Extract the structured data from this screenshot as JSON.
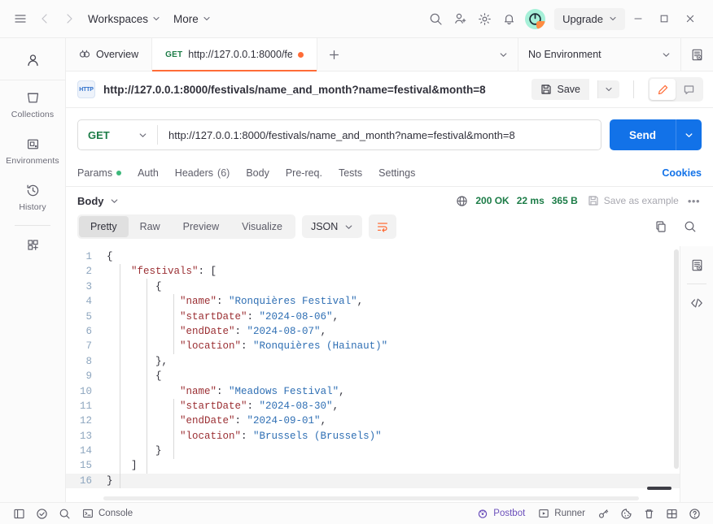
{
  "topbar": {
    "menu_icon": "hamburger-icon",
    "back_icon": "arrow-left-icon",
    "forward_icon": "arrow-right-icon",
    "workspaces_label": "Workspaces",
    "more_label": "More",
    "search_icon": "search-icon",
    "invite_icon": "invite-user-icon",
    "settings_icon": "gear-icon",
    "notifications_icon": "bell-icon",
    "avatar_label": "avatar",
    "upgrade_label": "Upgrade",
    "minimize_icon": "minimize-icon",
    "maximize_icon": "maximize-icon",
    "close_icon": "close-icon"
  },
  "sidebar": {
    "user_icon": "person-icon",
    "items": [
      {
        "label": "Collections",
        "icon": "collections-icon"
      },
      {
        "label": "Environments",
        "icon": "environments-icon"
      },
      {
        "label": "History",
        "icon": "history-clock-icon"
      }
    ],
    "add_module_icon": "grid-plus-icon"
  },
  "tabs": {
    "overview_label": "Overview",
    "request_method": "GET",
    "request_title": "http://127.0.0.1:8000/fe",
    "unsaved_dot": "unsaved-indicator",
    "new_tab_label": "+",
    "environment_label": "No Environment",
    "env_quick_look_icon": "environment-quick-look-icon"
  },
  "request": {
    "protocol_badge": "HTTP",
    "name": "http://127.0.0.1:8000/festivals/name_and_month?name=festival&month=8",
    "save_label": "Save",
    "edit_icon": "pencil-icon",
    "comment_icon": "comment-icon",
    "method": "GET",
    "url": "http://127.0.0.1:8000/festivals/name_and_month?name=festival&month=8",
    "send_label": "Send",
    "code_icon": "code-snippet-icon",
    "tabs": [
      {
        "label": "Params",
        "badge": "dot"
      },
      {
        "label": "Auth",
        "badge": ""
      },
      {
        "label": "Headers",
        "badge": "(6)"
      },
      {
        "label": "Body",
        "badge": ""
      },
      {
        "label": "Pre-req.",
        "badge": ""
      },
      {
        "label": "Tests",
        "badge": ""
      },
      {
        "label": "Settings",
        "badge": ""
      }
    ],
    "cookies_label": "Cookies"
  },
  "response": {
    "body_label": "Body",
    "globe_icon": "globe-icon",
    "status": "200 OK",
    "time": "22 ms",
    "size": "365 B",
    "save_example_label": "Save as example",
    "more_icon": "more-options-icon",
    "view_tabs": [
      {
        "label": "Pretty",
        "active": true
      },
      {
        "label": "Raw",
        "active": false
      },
      {
        "label": "Preview",
        "active": false
      },
      {
        "label": "Visualize",
        "active": false
      }
    ],
    "format": "JSON",
    "wrap_icon": "wrap-lines-icon",
    "copy_icon": "copy-icon",
    "search_icon": "search-icon",
    "body_lines": [
      {
        "n": 1,
        "indent": 0,
        "tokens": [
          {
            "t": "p",
            "v": "{"
          }
        ]
      },
      {
        "n": 2,
        "indent": 1,
        "tokens": [
          {
            "t": "k",
            "v": "\"festivals\""
          },
          {
            "t": "p",
            "v": ": ["
          }
        ]
      },
      {
        "n": 3,
        "indent": 2,
        "tokens": [
          {
            "t": "p",
            "v": "{"
          }
        ]
      },
      {
        "n": 4,
        "indent": 3,
        "tokens": [
          {
            "t": "k",
            "v": "\"name\""
          },
          {
            "t": "p",
            "v": ": "
          },
          {
            "t": "s",
            "v": "\"Ronquières Festival\""
          },
          {
            "t": "p",
            "v": ","
          }
        ]
      },
      {
        "n": 5,
        "indent": 3,
        "tokens": [
          {
            "t": "k",
            "v": "\"startDate\""
          },
          {
            "t": "p",
            "v": ": "
          },
          {
            "t": "s",
            "v": "\"2024-08-06\""
          },
          {
            "t": "p",
            "v": ","
          }
        ]
      },
      {
        "n": 6,
        "indent": 3,
        "tokens": [
          {
            "t": "k",
            "v": "\"endDate\""
          },
          {
            "t": "p",
            "v": ": "
          },
          {
            "t": "s",
            "v": "\"2024-08-07\""
          },
          {
            "t": "p",
            "v": ","
          }
        ]
      },
      {
        "n": 7,
        "indent": 3,
        "tokens": [
          {
            "t": "k",
            "v": "\"location\""
          },
          {
            "t": "p",
            "v": ": "
          },
          {
            "t": "s",
            "v": "\"Ronquières (Hainaut)\""
          }
        ]
      },
      {
        "n": 8,
        "indent": 2,
        "tokens": [
          {
            "t": "p",
            "v": "},"
          }
        ]
      },
      {
        "n": 9,
        "indent": 2,
        "tokens": [
          {
            "t": "p",
            "v": "{"
          }
        ]
      },
      {
        "n": 10,
        "indent": 3,
        "tokens": [
          {
            "t": "k",
            "v": "\"name\""
          },
          {
            "t": "p",
            "v": ": "
          },
          {
            "t": "s",
            "v": "\"Meadows Festival\""
          },
          {
            "t": "p",
            "v": ","
          }
        ]
      },
      {
        "n": 11,
        "indent": 3,
        "tokens": [
          {
            "t": "k",
            "v": "\"startDate\""
          },
          {
            "t": "p",
            "v": ": "
          },
          {
            "t": "s",
            "v": "\"2024-08-30\""
          },
          {
            "t": "p",
            "v": ","
          }
        ]
      },
      {
        "n": 12,
        "indent": 3,
        "tokens": [
          {
            "t": "k",
            "v": "\"endDate\""
          },
          {
            "t": "p",
            "v": ": "
          },
          {
            "t": "s",
            "v": "\"2024-09-01\""
          },
          {
            "t": "p",
            "v": ","
          }
        ]
      },
      {
        "n": 13,
        "indent": 3,
        "tokens": [
          {
            "t": "k",
            "v": "\"location\""
          },
          {
            "t": "p",
            "v": ": "
          },
          {
            "t": "s",
            "v": "\"Brussels (Brussels)\""
          }
        ]
      },
      {
        "n": 14,
        "indent": 2,
        "tokens": [
          {
            "t": "p",
            "v": "}"
          }
        ]
      },
      {
        "n": 15,
        "indent": 1,
        "tokens": [
          {
            "t": "p",
            "v": "]"
          }
        ]
      },
      {
        "n": 16,
        "indent": 0,
        "tokens": [
          {
            "t": "p",
            "v": "}"
          }
        ],
        "highlight": true
      }
    ]
  },
  "statusbar": {
    "left": [
      {
        "label": "",
        "icon": "sidebar-toggle-icon"
      },
      {
        "label": "",
        "icon": "check-circle-icon"
      },
      {
        "label": "",
        "icon": "search-icon"
      },
      {
        "label": "Console",
        "icon": "console-icon"
      }
    ],
    "right": [
      {
        "label": "Postbot",
        "icon": "postbot-icon"
      },
      {
        "label": "Runner",
        "icon": "runner-icon"
      },
      {
        "label": "",
        "icon": "vault-key-icon"
      },
      {
        "label": "",
        "icon": "cookies-icon"
      },
      {
        "label": "",
        "icon": "trash-icon"
      },
      {
        "label": "",
        "icon": "layout-icon"
      },
      {
        "label": "",
        "icon": "help-icon"
      }
    ]
  },
  "colors": {
    "accent": "#ff6c37",
    "send": "#1272e8",
    "success": "#1c7c47",
    "link": "#1272e8",
    "postbot": "#6b4fbb",
    "json_key": "#9b2f33",
    "json_string": "#2f6fb4"
  }
}
